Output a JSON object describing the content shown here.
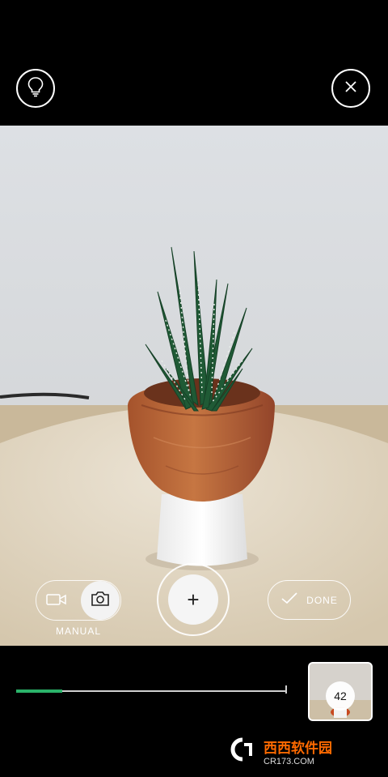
{
  "mode_toggle": {
    "label": "MANUAL",
    "video_icon": "video-camera-icon",
    "photo_icon": "camera-icon"
  },
  "capture": {
    "symbol": "+"
  },
  "done_button": {
    "label": "DONE",
    "icon": "checkmark-icon"
  },
  "thumbnail": {
    "count": "42"
  },
  "progress": {
    "fraction": 0.17,
    "color": "#2bb36a"
  },
  "top_bar": {
    "hint_icon": "lightbulb-icon",
    "close_icon": "close-icon"
  },
  "watermark": {
    "text": "西西软件园",
    "subtext": "CR173.COM"
  }
}
